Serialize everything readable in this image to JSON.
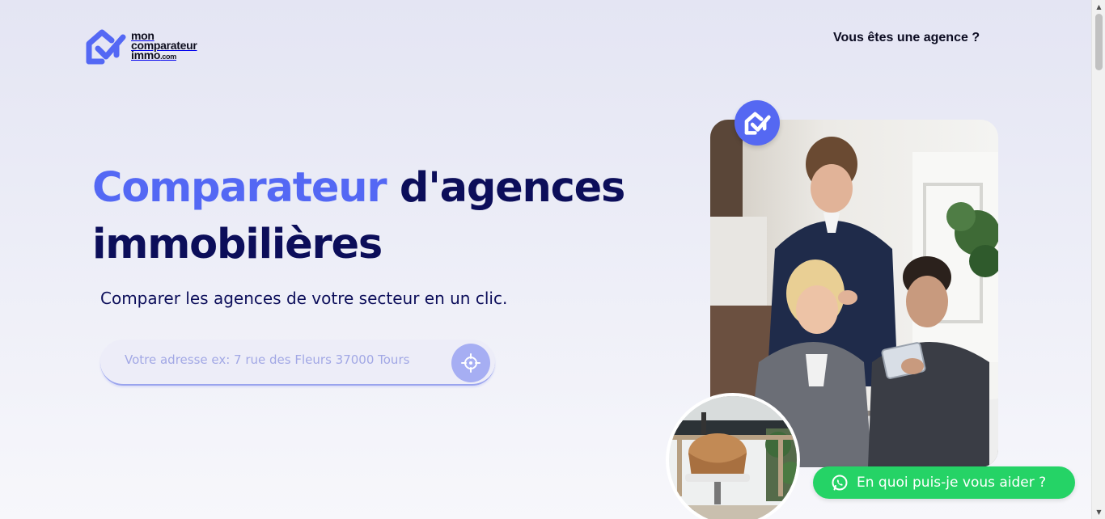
{
  "header": {
    "logo": {
      "line1": "mon",
      "line2": "comparateur",
      "line3": "immo",
      "line3_suffix": ".com"
    },
    "agency_link": "Vous êtes une agence ?"
  },
  "hero": {
    "title_accent": "Comparateur",
    "title_rest_1": " d'agences",
    "title_line2": "immobilières",
    "subtitle": "Comparer les agences de votre secteur en un clic.",
    "search": {
      "placeholder": "Votre adresse ex: 7 rue des Fleurs 37000 Tours",
      "value": ""
    }
  },
  "chat": {
    "label": "En quoi puis-je vous aider ?"
  },
  "colors": {
    "accent": "#5468f4",
    "navy": "#0c0e5a",
    "whatsapp": "#25d366",
    "search_button": "#a6aef3"
  },
  "icons": {
    "logo": "house-check-icon",
    "locate": "crosshair-icon",
    "chat": "whatsapp-icon",
    "badge": "house-check-icon"
  }
}
